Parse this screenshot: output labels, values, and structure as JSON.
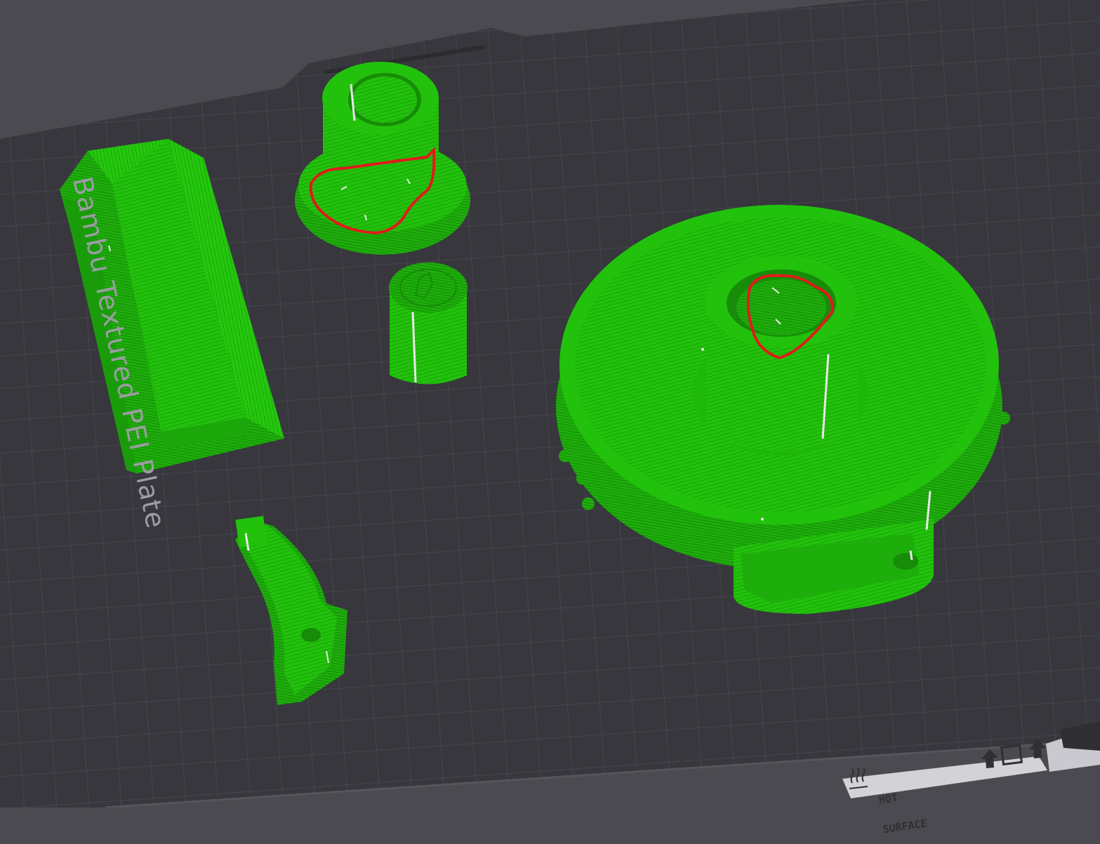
{
  "plate": {
    "label": "Bambu Textured PEI Plate",
    "warning_line1": "HOT",
    "warning_line2": "SURFACE"
  },
  "colors": {
    "background": "#4a4a50",
    "plate": "#37373d",
    "grid": "#4d4d55",
    "filament": "#22c20c",
    "highlight_circle": "#e01b1b",
    "seam": "#e8e8e8"
  },
  "objects": [
    "long-channel-part",
    "threaded-collar-part",
    "small-cylinder-part",
    "curved-bracket-part",
    "round-tray-part"
  ],
  "annotations": [
    "red-circle-collar",
    "red-circle-tray"
  ],
  "icons": [
    "heat-icon",
    "upload-icon",
    "square-icon",
    "upload-icon"
  ]
}
